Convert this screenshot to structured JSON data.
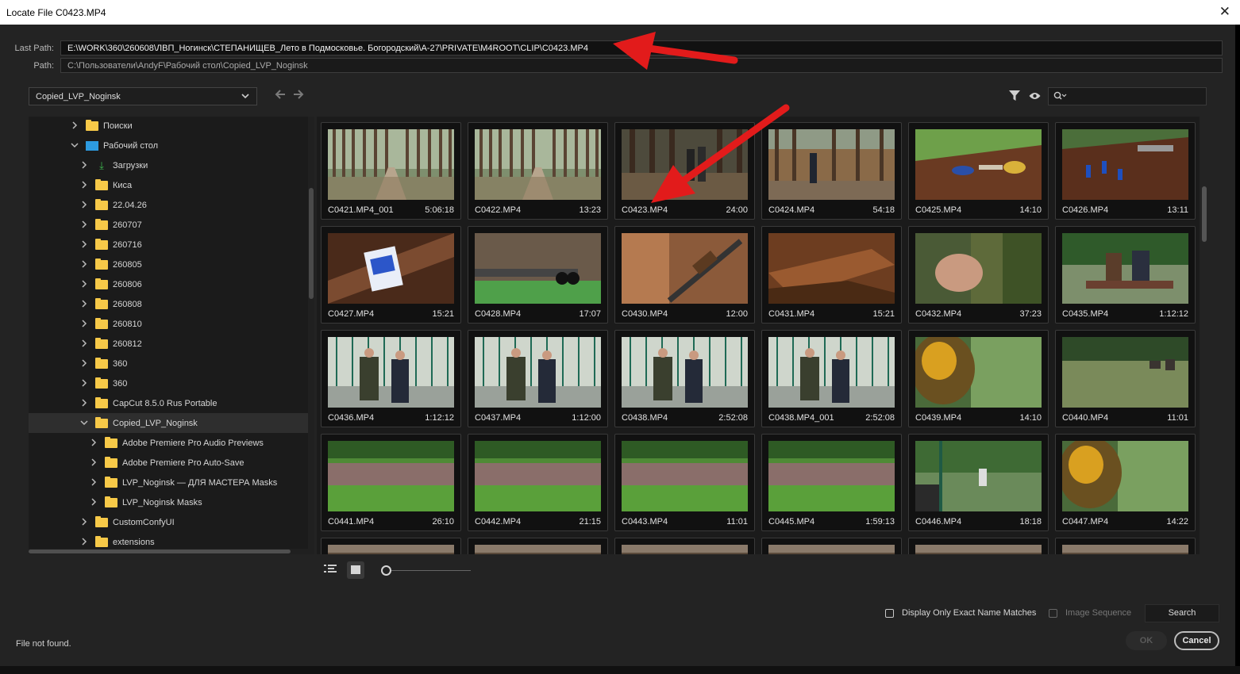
{
  "window": {
    "title": "Locate File C0423.MP4",
    "close_glyph": "✕"
  },
  "paths": {
    "last_label": "Last Path:",
    "last_value": "E:\\WORK\\360\\260608\\ЛВП_Ногинск\\СТЕПАНИЩЕВ_Лето в Подмосковье. Богородский\\A-27\\PRIVATE\\M4ROOT\\CLIP\\C0423.MP4",
    "path_label": "Path:",
    "path_value": "C:\\Пользователи\\AndyF\\Рабочий стол\\Copied_LVP_Noginsk"
  },
  "location_dropdown": {
    "value": "Copied_LVP_Noginsk",
    "chevron": "⌄"
  },
  "nav": {
    "back_glyph": "🡐",
    "forward_glyph": "🡒"
  },
  "tree": [
    {
      "label": "Поиски",
      "icon": "folder",
      "indent": 1,
      "expanded": false
    },
    {
      "label": "Рабочий стол",
      "icon": "desktop-folder",
      "indent": 1,
      "expanded": true
    },
    {
      "label": "Загрузки",
      "icon": "download",
      "indent": 2,
      "expanded": false
    },
    {
      "label": "Киса",
      "icon": "folder",
      "indent": 2,
      "expanded": false
    },
    {
      "label": "22.04.26",
      "icon": "folder",
      "indent": 2,
      "expanded": false
    },
    {
      "label": "260707",
      "icon": "folder",
      "indent": 2,
      "expanded": false
    },
    {
      "label": "260716",
      "icon": "folder",
      "indent": 2,
      "expanded": false
    },
    {
      "label": "260805",
      "icon": "folder",
      "indent": 2,
      "expanded": false
    },
    {
      "label": "260806",
      "icon": "folder",
      "indent": 2,
      "expanded": false
    },
    {
      "label": "260808",
      "icon": "folder",
      "indent": 2,
      "expanded": false
    },
    {
      "label": "260810",
      "icon": "folder",
      "indent": 2,
      "expanded": false
    },
    {
      "label": "260812",
      "icon": "folder",
      "indent": 2,
      "expanded": false
    },
    {
      "label": "360",
      "icon": "folder",
      "indent": 2,
      "expanded": false
    },
    {
      "label": "360",
      "icon": "folder",
      "indent": 2,
      "expanded": false
    },
    {
      "label": "CapCut 8.5.0 Rus Portable",
      "icon": "folder",
      "indent": 2,
      "expanded": false
    },
    {
      "label": "Copied_LVP_Noginsk",
      "icon": "folder",
      "indent": 2,
      "expanded": true,
      "selected": true
    },
    {
      "label": "Adobe Premiere Pro Audio Previews",
      "icon": "folder",
      "indent": 3,
      "expanded": false
    },
    {
      "label": "Adobe Premiere Pro Auto-Save",
      "icon": "folder",
      "indent": 3,
      "expanded": false
    },
    {
      "label": "LVP_Noginsk — ДЛЯ МАСТЕРА Masks",
      "icon": "folder",
      "indent": 3,
      "expanded": false
    },
    {
      "label": "LVP_Noginsk Masks",
      "icon": "folder",
      "indent": 3,
      "expanded": false
    },
    {
      "label": "CustomConfyUI",
      "icon": "folder",
      "indent": 2,
      "expanded": false
    },
    {
      "label": "extensions",
      "icon": "folder",
      "indent": 2,
      "expanded": false
    }
  ],
  "clips": [
    {
      "name": "C0421.MP4_001",
      "duration": "5:06:18",
      "scene": "forest-path"
    },
    {
      "name": "C0422.MP4",
      "duration": "13:23",
      "scene": "forest-path"
    },
    {
      "name": "C0423.MP4",
      "duration": "24:00",
      "scene": "forest-people"
    },
    {
      "name": "C0424.MP4",
      "duration": "54:18",
      "scene": "forest-fence"
    },
    {
      "name": "C0425.MP4",
      "duration": "14:10",
      "scene": "table-items"
    },
    {
      "name": "C0426.MP4",
      "duration": "13:11",
      "scene": "table-shells"
    },
    {
      "name": "C0427.MP4",
      "duration": "15:21",
      "scene": "shell-box"
    },
    {
      "name": "C0428.MP4",
      "duration": "17:07",
      "scene": "gun-barrel"
    },
    {
      "name": "C0430.MP4",
      "duration": "12:00",
      "scene": "gun-table"
    },
    {
      "name": "C0431.MP4",
      "duration": "15:21",
      "scene": "gun-stock"
    },
    {
      "name": "C0432.MP4",
      "duration": "37:23",
      "scene": "hand-closeup"
    },
    {
      "name": "C0435.MP4",
      "duration": "1:12:12",
      "scene": "two-men-table"
    },
    {
      "name": "C0436.MP4",
      "duration": "1:12:12",
      "scene": "range-men"
    },
    {
      "name": "C0437.MP4",
      "duration": "1:12:00",
      "scene": "range-men"
    },
    {
      "name": "C0438.MP4",
      "duration": "2:52:08",
      "scene": "range-men"
    },
    {
      "name": "C0438.MP4_001",
      "duration": "2:52:08",
      "scene": "range-men"
    },
    {
      "name": "C0439.MP4",
      "duration": "14:10",
      "scene": "blur-ear"
    },
    {
      "name": "C0440.MP4",
      "duration": "11:01",
      "scene": "field-targets"
    },
    {
      "name": "C0441.MP4",
      "duration": "26:10",
      "scene": "grass-field"
    },
    {
      "name": "C0442.MP4",
      "duration": "21:15",
      "scene": "grass-field"
    },
    {
      "name": "C0443.MP4",
      "duration": "11:01",
      "scene": "grass-field"
    },
    {
      "name": "C0445.MP4",
      "duration": "1:59:13",
      "scene": "grass-field"
    },
    {
      "name": "C0446.MP4",
      "duration": "18:18",
      "scene": "range-post"
    },
    {
      "name": "C0447.MP4",
      "duration": "14:22",
      "scene": "blur-ear"
    },
    {
      "name": "",
      "duration": "",
      "scene": "partial"
    },
    {
      "name": "",
      "duration": "",
      "scene": "partial"
    },
    {
      "name": "",
      "duration": "",
      "scene": "partial"
    },
    {
      "name": "",
      "duration": "",
      "scene": "partial"
    },
    {
      "name": "",
      "duration": "",
      "scene": "partial"
    },
    {
      "name": "",
      "duration": "",
      "scene": "partial"
    }
  ],
  "options": {
    "exact_match_label": "Display Only Exact Name Matches",
    "image_sequence_label": "Image Sequence",
    "search_label": "Search"
  },
  "buttons": {
    "ok": "OK",
    "cancel": "Cancel"
  },
  "status": "File not found.",
  "colors": {
    "annotation_arrow": "#e21b1b",
    "folder": "#f7c948",
    "desktop_folder": "#2d9be0"
  }
}
